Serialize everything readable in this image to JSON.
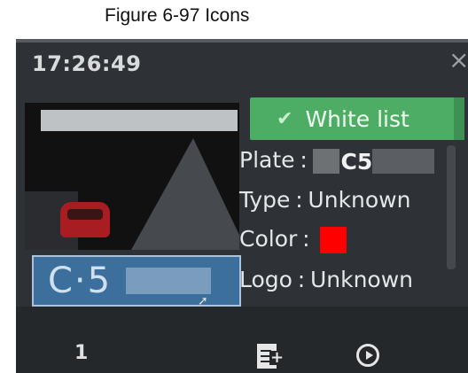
{
  "caption": "Figure 6-97 Icons",
  "panel": {
    "time": "17:26:49",
    "close_glyph": "×",
    "badge": {
      "check_glyph": "✔",
      "label": "White list"
    },
    "details": {
      "plate_label": "Plate",
      "plate_value": "C5",
      "type_label": "Type",
      "type_value": "Unknown",
      "color_label": "Color",
      "color_value": "#ff0000",
      "logo_label": "Logo",
      "logo_value": "Unknown",
      "separator": ":"
    },
    "plate_thumbnail_text": "C·5",
    "footer": {
      "count": "1",
      "icons": [
        "add-page-icon",
        "play-icon"
      ]
    }
  }
}
